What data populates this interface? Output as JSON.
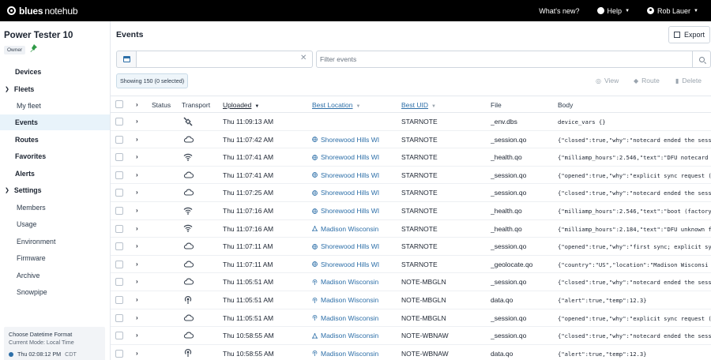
{
  "topbar": {
    "logo_brand": "blues",
    "logo_product": "notehub",
    "whats_new": "What's new?",
    "help": "Help",
    "user": "Rob Lauer"
  },
  "sidebar": {
    "project_title": "Power Tester 10",
    "owner_badge": "Owner",
    "nav": {
      "devices": "Devices",
      "fleets": "Fleets",
      "my_fleet": "My fleet",
      "events": "Events",
      "routes": "Routes",
      "favorites": "Favorites",
      "alerts": "Alerts",
      "settings": "Settings",
      "members": "Members",
      "usage": "Usage",
      "environment": "Environment",
      "firmware": "Firmware",
      "archive": "Archive",
      "snowpipe": "Snowpipe"
    },
    "datetime": {
      "title": "Choose Datetime Format",
      "mode": "Current Mode: Local Time",
      "time": "Thu 02:08:12 PM",
      "tz": "CDT"
    }
  },
  "main": {
    "title": "Events",
    "export_label": "Export",
    "filter_placeholder": "Filter events",
    "showing": "Showing 150 (0 selected)",
    "actions": {
      "view": "View",
      "route": "Route",
      "delete": "Delete"
    },
    "columns": {
      "status": "Status",
      "transport": "Transport",
      "uploaded": "Uploaded",
      "best_location": "Best Location",
      "best_uid": "Best UID",
      "file": "File",
      "body": "Body"
    },
    "rows": [
      {
        "transport": "satellite",
        "uploaded": "Thu 11:09:13 AM",
        "location": "",
        "loc_icon": "",
        "uid": "STARNOTE",
        "file": "_env.dbs",
        "body": "device_vars {}"
      },
      {
        "transport": "cloud",
        "uploaded": "Thu 11:07:42 AM",
        "location": "Shorewood Hills WI",
        "loc_icon": "globe",
        "uid": "STARNOTE",
        "file": "_session.qo",
        "body": "{\"closed\":true,\"why\":\"notecard ended the sess"
      },
      {
        "transport": "wifi",
        "uploaded": "Thu 11:07:41 AM",
        "location": "Shorewood Hills WI",
        "loc_icon": "globe",
        "uid": "STARNOTE",
        "file": "_health.qo",
        "body": "{\"milliamp_hours\":2.546,\"text\":\"DFU notecard"
      },
      {
        "transport": "cloud",
        "uploaded": "Thu 11:07:41 AM",
        "location": "Shorewood Hills WI",
        "loc_icon": "globe",
        "uid": "STARNOTE",
        "file": "_session.qo",
        "body": "{\"opened\":true,\"why\":\"explicit sync request ("
      },
      {
        "transport": "cloud",
        "uploaded": "Thu 11:07:25 AM",
        "location": "Shorewood Hills WI",
        "loc_icon": "globe",
        "uid": "STARNOTE",
        "file": "_session.qo",
        "body": "{\"closed\":true,\"why\":\"notecard ended the sess"
      },
      {
        "transport": "wifi",
        "uploaded": "Thu 11:07:16 AM",
        "location": "Shorewood Hills WI",
        "loc_icon": "globe",
        "uid": "STARNOTE",
        "file": "_health.qo",
        "body": "{\"milliamp_hours\":2.546,\"text\":\"boot (factory"
      },
      {
        "transport": "wifi",
        "uploaded": "Thu 11:07:16 AM",
        "location": "Madison Wisconsin",
        "loc_icon": "triangulate",
        "uid": "STARNOTE",
        "file": "_health.qo",
        "body": "{\"milliamp_hours\":2.184,\"text\":\"DFU unknown f"
      },
      {
        "transport": "cloud",
        "uploaded": "Thu 11:07:11 AM",
        "location": "Shorewood Hills WI",
        "loc_icon": "globe",
        "uid": "STARNOTE",
        "file": "_session.qo",
        "body": "{\"opened\":true,\"why\":\"first sync; explicit sy"
      },
      {
        "transport": "cloud",
        "uploaded": "Thu 11:07:11 AM",
        "location": "Shorewood Hills WI",
        "loc_icon": "globe",
        "uid": "STARNOTE",
        "file": "_geolocate.qo",
        "body": "{\"country\":\"US\",\"location\":\"Madison Wisconsi"
      },
      {
        "transport": "cloud",
        "uploaded": "Thu 11:05:51 AM",
        "location": "Madison Wisconsin",
        "loc_icon": "tower",
        "uid": "NOTE-MBGLN",
        "file": "_session.qo",
        "body": "{\"closed\":true,\"why\":\"notecard ended the sess"
      },
      {
        "transport": "radio",
        "uploaded": "Thu 11:05:51 AM",
        "location": "Madison Wisconsin",
        "loc_icon": "tower",
        "uid": "NOTE-MBGLN",
        "file": "data.qo",
        "body": "{\"alert\":true,\"temp\":12.3}"
      },
      {
        "transport": "cloud",
        "uploaded": "Thu 11:05:51 AM",
        "location": "Madison Wisconsin",
        "loc_icon": "tower",
        "uid": "NOTE-MBGLN",
        "file": "_session.qo",
        "body": "{\"opened\":true,\"why\":\"explicit sync request ("
      },
      {
        "transport": "cloud",
        "uploaded": "Thu 10:58:55 AM",
        "location": "Madison Wisconsin",
        "loc_icon": "triangulate",
        "uid": "NOTE-WBNAW",
        "file": "_session.qo",
        "body": "{\"closed\":true,\"why\":\"notecard ended the sess"
      },
      {
        "transport": "radio",
        "uploaded": "Thu 10:58:55 AM",
        "location": "Madison Wisconsin",
        "loc_icon": "tower",
        "uid": "NOTE-WBNAW",
        "file": "data.qo",
        "body": "{\"alert\":true,\"temp\":12.3}"
      }
    ]
  }
}
